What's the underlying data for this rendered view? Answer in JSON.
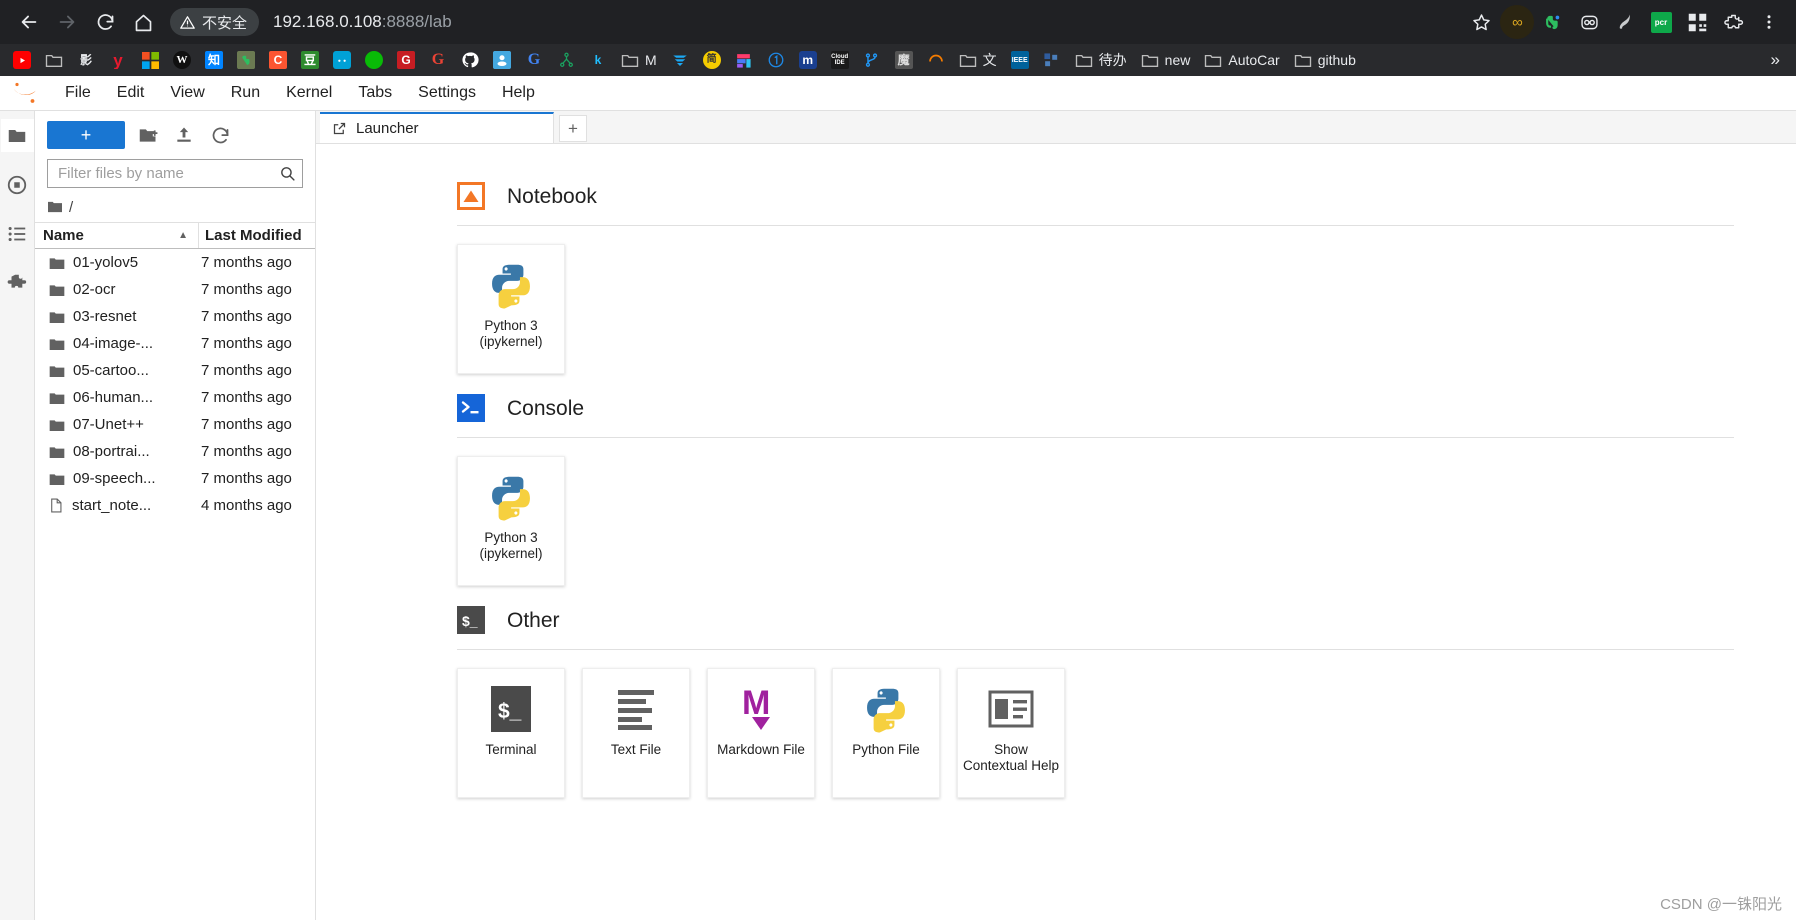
{
  "browser": {
    "back_label": "Back",
    "forward_label": "Forward",
    "reload_label": "Reload",
    "home_label": "Home",
    "security_text": "不安全",
    "url_host": "192.168.0.108",
    "url_rest": ":8888/lab",
    "bookmark_star": "star-icon",
    "extensions": [
      {
        "name": "infinity-extension-icon",
        "glyph": "∞",
        "color": "#d9a520",
        "bg": "#2b2512"
      },
      {
        "name": "evernote-extension-icon",
        "glyph": "",
        "color": "#2dbe60",
        "bg": "transparent"
      },
      {
        "name": "pocket-extension-icon",
        "glyph": "",
        "color": "#e8eaed",
        "bg": "transparent"
      },
      {
        "name": "bird-extension-icon",
        "glyph": "",
        "color": "#bdbdbd",
        "bg": "transparent"
      },
      {
        "name": "qr-scan-extension-icon",
        "glyph": "pcr",
        "color": "#ffffff",
        "bg": "#0ea84a"
      },
      {
        "name": "qrcode-extension-icon",
        "glyph": "",
        "color": "#ffffff",
        "bg": "transparent"
      },
      {
        "name": "puzzle-extensions-icon",
        "glyph": "",
        "color": "#e8eaed",
        "bg": "transparent"
      }
    ],
    "bookmarks": [
      {
        "label": "",
        "icon": "youtube-icon",
        "glyph": "▶",
        "fg": "#ffffff",
        "bg": "#ff0000",
        "radius": "3px"
      },
      {
        "label": "",
        "icon": "folder-icon",
        "glyph": "",
        "fg": "#bdbdbd",
        "bg": "transparent",
        "radius": "0"
      },
      {
        "label": "",
        "icon": "ying-icon",
        "glyph": "影",
        "fg": "#e8eaed",
        "bg": "transparent",
        "radius": "0"
      },
      {
        "label": "",
        "icon": "yy-icon",
        "glyph": "y",
        "fg": "#e8192e",
        "bg": "transparent",
        "radius": "0"
      },
      {
        "label": "",
        "icon": "microsoft-icon",
        "glyph": "",
        "fg": "#ffffff",
        "bg": "transparent",
        "radius": "0"
      },
      {
        "label": "",
        "icon": "wikipedia-icon",
        "glyph": "W",
        "fg": "#ffffff",
        "bg": "#101010",
        "radius": "50%"
      },
      {
        "label": "",
        "icon": "zhihu-icon",
        "glyph": "知",
        "fg": "#ffffff",
        "bg": "#0084ff",
        "radius": "2px"
      },
      {
        "label": "",
        "icon": "evernote-icon",
        "glyph": "",
        "fg": "#2dbe60",
        "bg": "#6b7a52",
        "radius": "2px"
      },
      {
        "label": "",
        "icon": "csdn-icon",
        "glyph": "C",
        "fg": "#ffffff",
        "bg": "#fc5531",
        "radius": "2px"
      },
      {
        "label": "",
        "icon": "douban-icon",
        "glyph": "豆",
        "fg": "#ffffff",
        "bg": "#2e8b2e",
        "radius": "2px"
      },
      {
        "label": "",
        "icon": "bilibili-icon",
        "glyph": "",
        "fg": "#ffffff",
        "bg": "#00a1d6",
        "radius": "3px"
      },
      {
        "label": "",
        "icon": "wechat-icon",
        "glyph": "",
        "fg": "#ffffff",
        "bg": "#09bb07",
        "radius": "50%"
      },
      {
        "label": "",
        "icon": "gitee-icon",
        "glyph": "G",
        "fg": "#ffffff",
        "bg": "#c71d23",
        "radius": "2px"
      },
      {
        "label": "",
        "icon": "google-red-icon",
        "glyph": "G",
        "fg": "#ea4335",
        "bg": "transparent",
        "radius": "0"
      },
      {
        "label": "",
        "icon": "github-icon",
        "glyph": "",
        "fg": "#ffffff",
        "bg": "transparent",
        "radius": "50%"
      },
      {
        "label": "",
        "icon": "anaconda-icon",
        "glyph": "",
        "fg": "#ffffff",
        "bg": "#44a8e0",
        "radius": "2px"
      },
      {
        "label": "",
        "icon": "google-icon",
        "glyph": "G",
        "fg": "#4285f4",
        "bg": "transparent",
        "radius": "0"
      },
      {
        "label": "",
        "icon": "gitlab-tree-icon",
        "glyph": "",
        "fg": "#1aa260",
        "bg": "transparent",
        "radius": "0"
      },
      {
        "label": "",
        "icon": "kaggle-icon",
        "glyph": "k",
        "fg": "#20beff",
        "bg": "transparent",
        "radius": "0"
      },
      {
        "label": "M",
        "icon": "folder-icon",
        "glyph": "",
        "fg": "#bdbdbd",
        "bg": "transparent",
        "radius": "0"
      },
      {
        "label": "",
        "icon": "elastic-icon",
        "glyph": "",
        "fg": "#1ba9f5",
        "bg": "transparent",
        "radius": "0"
      },
      {
        "label": "",
        "icon": "yellow-badge-icon",
        "glyph": "简",
        "fg": "#333333",
        "bg": "#f5cc00",
        "radius": "50%"
      },
      {
        "label": "",
        "icon": "figma-icon",
        "glyph": "",
        "fg": "#ffffff",
        "bg": "transparent",
        "radius": "0"
      },
      {
        "label": "",
        "icon": "one-circle-icon",
        "glyph": "①",
        "fg": "#1e88e5",
        "bg": "transparent",
        "radius": "0"
      },
      {
        "label": "",
        "icon": "m-square-icon",
        "glyph": "m",
        "fg": "#ffffff",
        "bg": "#1a3f8f",
        "radius": "3px"
      },
      {
        "label": "",
        "icon": "cloud-ide-icon",
        "glyph": "Cloud IDE",
        "fg": "#ffffff",
        "bg": "#1a1a1a",
        "radius": "2px"
      },
      {
        "label": "",
        "icon": "gitlab-branch-icon",
        "glyph": "",
        "fg": "#2196f3",
        "bg": "transparent",
        "radius": "0"
      },
      {
        "label": "",
        "icon": "mo-icon",
        "glyph": "魔",
        "fg": "#dddddd",
        "bg": "#555555",
        "radius": "2px"
      },
      {
        "label": "",
        "icon": "orange-arc-icon",
        "glyph": "",
        "fg": "#f57c00",
        "bg": "transparent",
        "radius": "0"
      },
      {
        "label": "文",
        "icon": "folder-icon",
        "glyph": "",
        "fg": "#bdbdbd",
        "bg": "transparent",
        "radius": "0"
      },
      {
        "label": "",
        "icon": "ieee-icon",
        "glyph": "IEEE",
        "fg": "#ffffff",
        "bg": "#00629b",
        "radius": "2px"
      },
      {
        "label": "",
        "icon": "blue-squares-icon",
        "glyph": "",
        "fg": "#4a7ebb",
        "bg": "transparent",
        "radius": "0"
      },
      {
        "label": "待办",
        "icon": "folder-icon",
        "glyph": "",
        "fg": "#bdbdbd",
        "bg": "transparent",
        "radius": "0"
      },
      {
        "label": "new",
        "icon": "folder-icon",
        "glyph": "",
        "fg": "#bdbdbd",
        "bg": "transparent",
        "radius": "0"
      },
      {
        "label": "AutoCar",
        "icon": "folder-icon",
        "glyph": "",
        "fg": "#bdbdbd",
        "bg": "transparent",
        "radius": "0"
      },
      {
        "label": "github",
        "icon": "folder-icon",
        "glyph": "",
        "fg": "#bdbdbd",
        "bg": "transparent",
        "radius": "0"
      }
    ],
    "overflow_label": "»"
  },
  "jupyter": {
    "menu_items": [
      "File",
      "Edit",
      "View",
      "Run",
      "Kernel",
      "Tabs",
      "Settings",
      "Help"
    ],
    "left_rail": [
      {
        "name": "file-browser-icon",
        "active": true
      },
      {
        "name": "running-terminals-icon",
        "active": false
      },
      {
        "name": "commands-icon",
        "active": false
      },
      {
        "name": "extension-manager-icon",
        "active": false
      }
    ],
    "filebrowser": {
      "new_launcher_label": "+",
      "new_folder_label": "new-folder",
      "upload_label": "upload",
      "refresh_label": "refresh",
      "filter_placeholder": "Filter files by name",
      "filter_value": "",
      "breadcrumb_root": "/",
      "columns": {
        "name": "Name",
        "last_modified": "Last Modified"
      },
      "sort_arrow": "▲",
      "files": [
        {
          "name": "01-yolov5",
          "modified": "7 months ago",
          "type": "folder"
        },
        {
          "name": "02-ocr",
          "modified": "7 months ago",
          "type": "folder"
        },
        {
          "name": "03-resnet",
          "modified": "7 months ago",
          "type": "folder"
        },
        {
          "name": "04-image-...",
          "modified": "7 months ago",
          "type": "folder"
        },
        {
          "name": "05-cartoo...",
          "modified": "7 months ago",
          "type": "folder"
        },
        {
          "name": "06-human...",
          "modified": "7 months ago",
          "type": "folder"
        },
        {
          "name": "07-Unet++",
          "modified": "7 months ago",
          "type": "folder"
        },
        {
          "name": "08-portrai...",
          "modified": "7 months ago",
          "type": "folder"
        },
        {
          "name": "09-speech...",
          "modified": "7 months ago",
          "type": "folder"
        },
        {
          "name": "start_note...",
          "modified": "4 months ago",
          "type": "file"
        }
      ]
    },
    "tabs": [
      {
        "label": "Launcher",
        "icon": "launcher-icon",
        "active": true
      }
    ],
    "add_tab_label": "+",
    "launcher": {
      "sections": [
        {
          "title": "Notebook",
          "icon": "notebook-icon",
          "cards": [
            {
              "label": "Python 3\n(ipykernel)",
              "icon": "python-icon",
              "tall": true
            }
          ]
        },
        {
          "title": "Console",
          "icon": "console-icon",
          "cards": [
            {
              "label": "Python 3\n(ipykernel)",
              "icon": "python-icon",
              "tall": true
            }
          ]
        },
        {
          "title": "Other",
          "icon": "other-terminal-icon",
          "cards": [
            {
              "label": "Terminal",
              "icon": "terminal-icon",
              "tall": true
            },
            {
              "label": "Text File",
              "icon": "text-file-icon",
              "tall": true
            },
            {
              "label": "Markdown File",
              "icon": "markdown-icon",
              "tall": true
            },
            {
              "label": "Python File",
              "icon": "python-icon",
              "tall": true
            },
            {
              "label": "Show Contextual Help",
              "icon": "contextual-help-icon",
              "tall": true
            }
          ]
        }
      ]
    }
  },
  "watermark": "CSDN @一铢阳光",
  "colors": {
    "accent": "#1976d2",
    "chrome_bg": "#202124",
    "bookmarks_bg": "#292a2d",
    "notebook_orange": "#f37726",
    "markdown_purple": "#a0219e"
  }
}
